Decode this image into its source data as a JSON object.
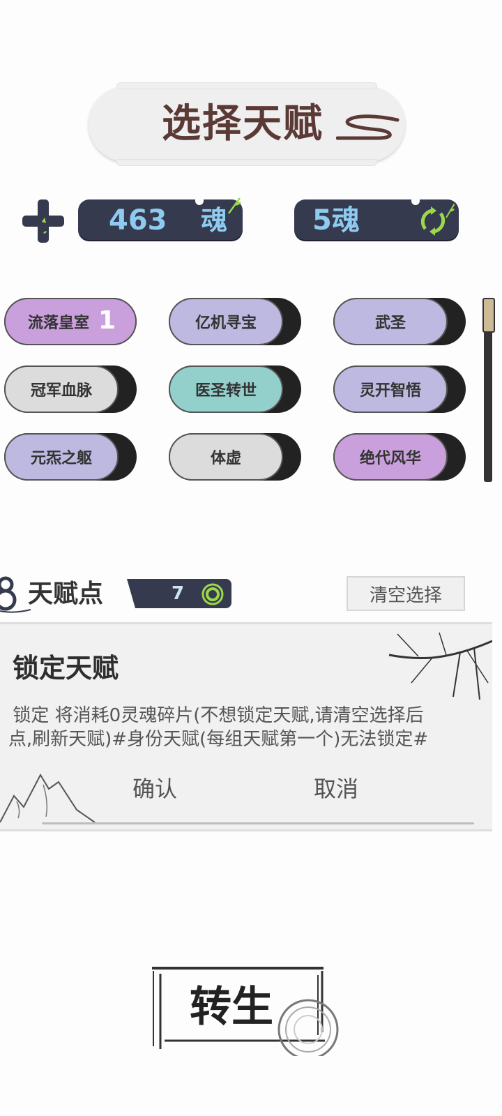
{
  "header": {
    "title": "选择天赋",
    "swirl_icon": "cloud-swirl-icon"
  },
  "currency": {
    "plus_icon": "plus-cross-icon",
    "souls": {
      "value": "463",
      "unit": "魂",
      "icon": "leaf-icon"
    },
    "refresh_cost": {
      "value": "5魂",
      "icon": "refresh-icon"
    }
  },
  "talents": [
    {
      "label": "流落皇室",
      "color": "#c9a0dc",
      "count": "1",
      "selected": true
    },
    {
      "label": "亿机寻宝",
      "color": "#bdb9e0"
    },
    {
      "label": "武圣",
      "color": "#bdb9e0"
    },
    {
      "label": "冠军血脉",
      "color": "#dcdcdc"
    },
    {
      "label": "医圣转世",
      "color": "#93cfcb"
    },
    {
      "label": "灵开智悟",
      "color": "#bdb9e0"
    },
    {
      "label": "元炁之躯",
      "color": "#bdb9e0"
    },
    {
      "label": "体虚",
      "color": "#dcdcdc"
    },
    {
      "label": "绝代风华",
      "color": "#c9a0dc"
    }
  ],
  "talent_points": {
    "label": "天赋点",
    "value": "7",
    "icon": "gourd-icon",
    "ring_icon": "ring-icon"
  },
  "clear_button": "清空选择",
  "dialog": {
    "title": "锁定天赋",
    "message": "锁定 将消耗0灵魂碎片(不想锁定天赋,请清空选择后点,刷新天赋)#身份天赋(每组天赋第一个)无法锁定#",
    "confirm": "确认",
    "cancel": "取消"
  },
  "rebirth_button": "转生",
  "colors": {
    "pill_dark": "#363a4e",
    "pill_text": "#8ecbf0",
    "leaf_green": "#9bd84a",
    "title_brown": "#5b3a36"
  }
}
